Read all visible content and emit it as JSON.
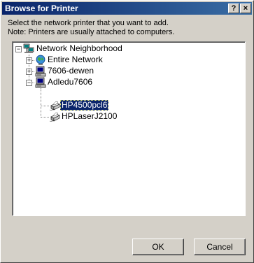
{
  "window": {
    "title": "Browse for Printer",
    "help_glyph": "?",
    "close_glyph": "×"
  },
  "instructions": {
    "line1": "Select the network printer that you want to add.",
    "line2": "Note: Printers are usually attached to computers."
  },
  "tree": {
    "root": {
      "label": "Network Neighborhood",
      "expander": "−",
      "icon": "network-neighborhood-icon"
    },
    "entire_network": {
      "label": "Entire Network",
      "expander": "+",
      "icon": "globe-icon"
    },
    "computer_1": {
      "label": "7606-dewen",
      "expander": "+",
      "icon": "computer-icon"
    },
    "computer_2": {
      "label": "Adledu7606",
      "expander": "−",
      "icon": "computer-icon"
    },
    "printer_1": {
      "label": "HP4500pcl6",
      "icon": "printer-icon",
      "selected": true
    },
    "printer_2": {
      "label": "HPLaserJ2100",
      "icon": "printer-icon"
    }
  },
  "buttons": {
    "ok": "OK",
    "cancel": "Cancel"
  }
}
